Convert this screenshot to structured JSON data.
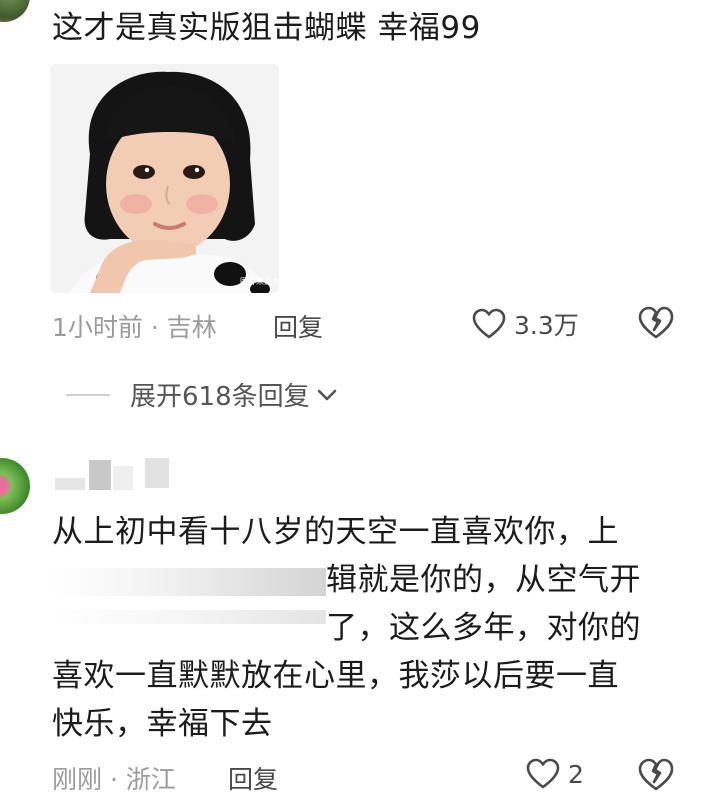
{
  "comments": [
    {
      "text_lines": [
        "这才是真实版狙击蝴蝶 幸福99"
      ],
      "meta": "1小时前 · 吉林",
      "reply_label": "回复",
      "likes": "3.3万",
      "expand_label": "展开618条回复",
      "image_watermark": "图片来源水印"
    },
    {
      "text_lines": [
        "从上初中看十八岁的天空一直喜欢你，上",
        "辑就是你的，从空气开",
        "了，这么多年，对你的",
        "喜欢一直默默放在心里，我莎以后要一直",
        "快乐，幸福下去"
      ],
      "meta": "刚刚 · 浙江",
      "reply_label": "回复",
      "likes": "2"
    }
  ]
}
